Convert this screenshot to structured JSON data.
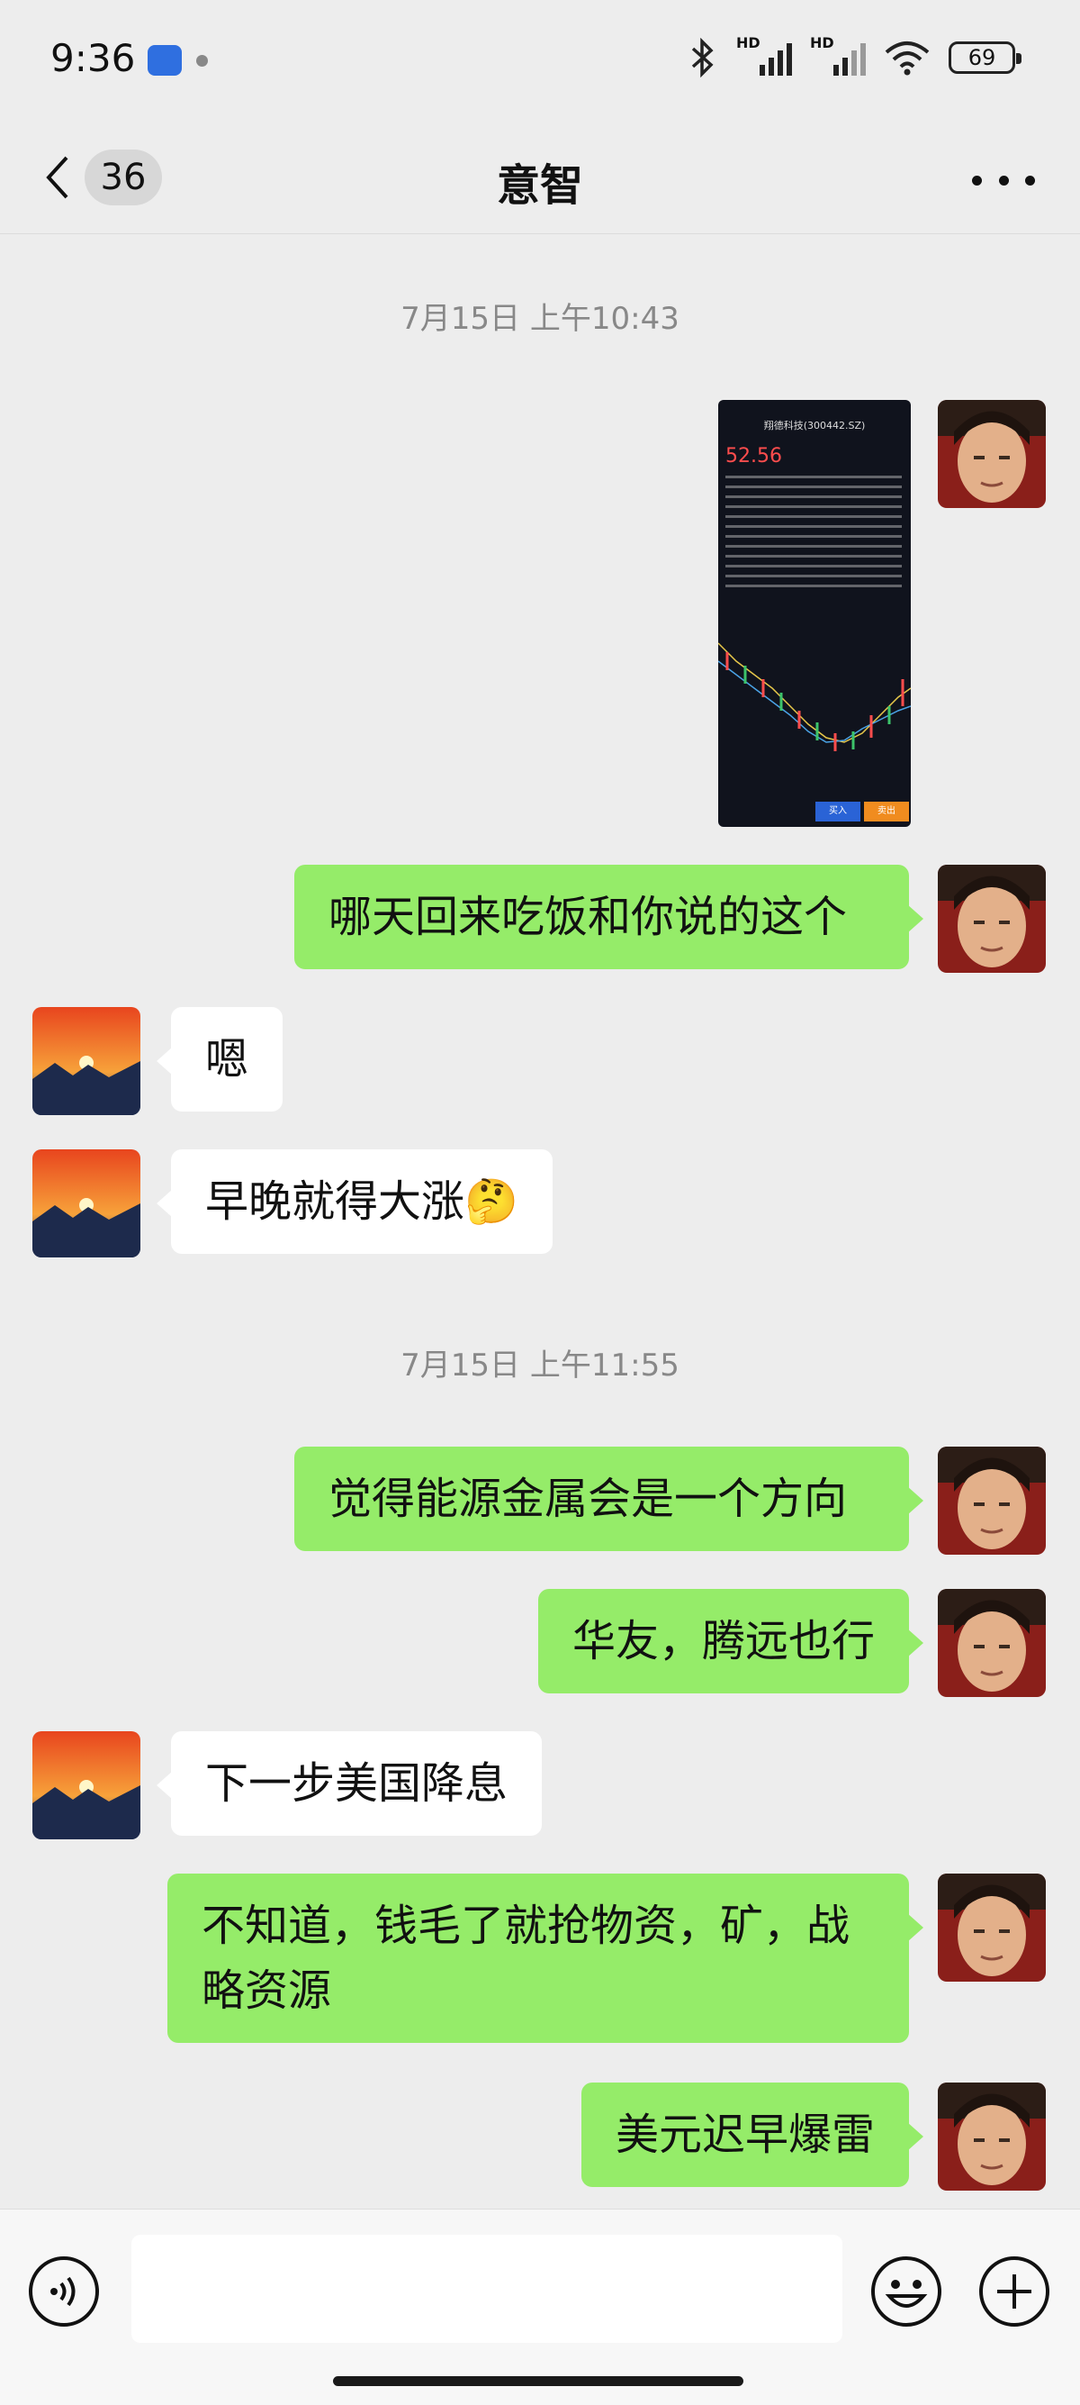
{
  "status_bar": {
    "time": "9:36",
    "signal_1_label": "HD",
    "signal_2_label": "HD",
    "battery": "69"
  },
  "header": {
    "unread_count": "36",
    "title": "意智"
  },
  "thumbnail": {
    "stock_title": "翔德科技(300442.SZ)",
    "price": "52.56",
    "buy_label": "买入",
    "sell_label": "卖出"
  },
  "messages": [
    {
      "kind": "timestamp",
      "text": "7月15日 上午10:43"
    },
    {
      "kind": "image",
      "side": "out"
    },
    {
      "kind": "text",
      "side": "out",
      "text": "哪天回来吃饭和你说的这个"
    },
    {
      "kind": "text",
      "side": "in",
      "text": "嗯"
    },
    {
      "kind": "text",
      "side": "in",
      "text": "早晚就得大涨🤔"
    },
    {
      "kind": "timestamp",
      "text": "7月15日 上午11:55"
    },
    {
      "kind": "text",
      "side": "out",
      "text": "觉得能源金属会是一个方向"
    },
    {
      "kind": "text",
      "side": "out",
      "text": "华友，腾远也行"
    },
    {
      "kind": "text",
      "side": "in",
      "text": "下一步美国降息"
    },
    {
      "kind": "text",
      "side": "out",
      "text": "不知道，钱毛了就抢物资，矿，战略资源"
    },
    {
      "kind": "text",
      "side": "out",
      "text": "美元迟早爆雷"
    }
  ],
  "input": {
    "value": "",
    "placeholder": ""
  },
  "colors": {
    "outgoing_bubble": "#95ec69",
    "incoming_bubble": "#ffffff",
    "background": "#ededed"
  },
  "icons": [
    "bluetooth-icon",
    "wifi-icon",
    "back-chevron-icon",
    "more-icon",
    "voice-icon",
    "emoji-icon",
    "plus-icon"
  ]
}
